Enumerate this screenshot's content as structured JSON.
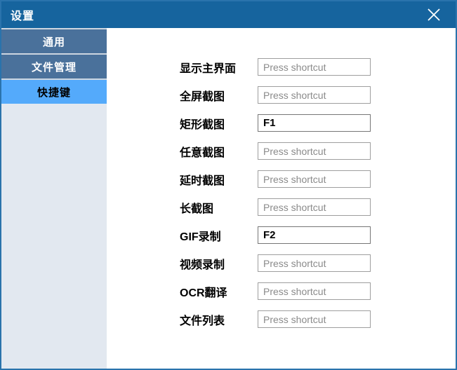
{
  "window": {
    "title": "设置"
  },
  "sidebar": {
    "items": [
      {
        "label": "通用"
      },
      {
        "label": "文件管理"
      },
      {
        "label": "快捷键"
      }
    ],
    "selected_index": 2
  },
  "shortcuts": {
    "placeholder": "Press shortcut",
    "rows": [
      {
        "label": "显示主界面",
        "value": ""
      },
      {
        "label": "全屏截图",
        "value": ""
      },
      {
        "label": "矩形截图",
        "value": "F1"
      },
      {
        "label": "任意截图",
        "value": ""
      },
      {
        "label": "延时截图",
        "value": ""
      },
      {
        "label": "长截图",
        "value": ""
      },
      {
        "label": "GIF录制",
        "value": "F2"
      },
      {
        "label": "视频录制",
        "value": ""
      },
      {
        "label": "OCR翻译",
        "value": ""
      },
      {
        "label": "文件列表",
        "value": ""
      }
    ]
  },
  "colors": {
    "titlebar_bg": "#16649E",
    "window_border": "#2A73AC",
    "tab_bg": "#4A719B",
    "tab_selected_bg": "#54AAFB",
    "sidebar_bg": "#E2E8F0",
    "tab_separator": "#CDD6E0",
    "input_border": "#9E9E9E",
    "placeholder_text": "#8A8A8A"
  }
}
